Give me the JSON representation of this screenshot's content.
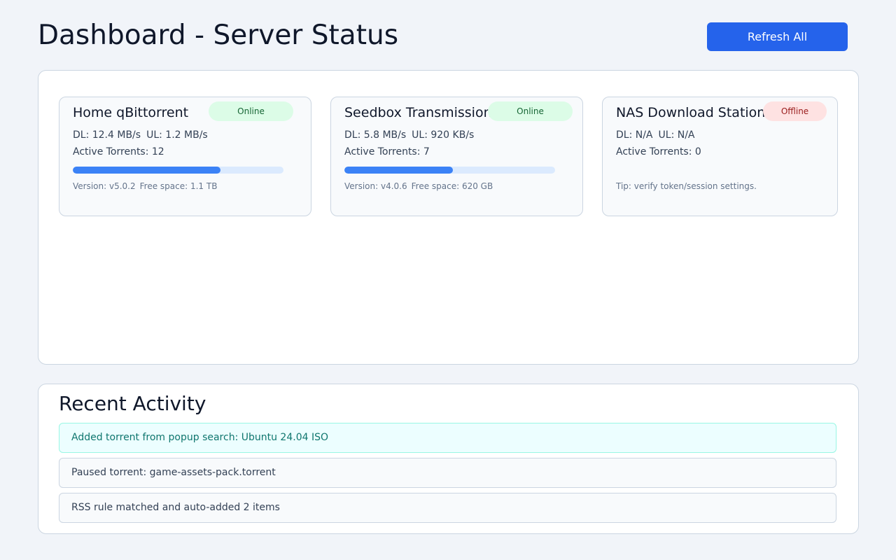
{
  "header": {
    "title": "Dashboard - Server Status",
    "refresh_label": "Refresh All"
  },
  "servers": [
    {
      "name": "Home qBittorrent",
      "status": "Online",
      "dl": "DL: 12.4 MB/s",
      "ul": "UL: 1.2 MB/s",
      "active": "Active Torrents: 12",
      "progress_percent": 70,
      "version": "Version: v5.0.2",
      "free_space": "Free space: 1.1 TB"
    },
    {
      "name": "Seedbox Transmission",
      "status": "Online",
      "dl": "DL: 5.8 MB/s",
      "ul": "UL: 920 KB/s",
      "active": "Active Torrents: 7",
      "progress_percent": 51.5,
      "version": "Version: v4.0.6",
      "free_space": "Free space: 620 GB"
    },
    {
      "name": "NAS Download Station",
      "status": "Offline",
      "dl": "DL: N/A",
      "ul": "UL: N/A",
      "active": "Active Torrents: 0",
      "tip": "Tip: verify token/session settings."
    }
  ],
  "activity": {
    "title": "Recent Activity",
    "items": [
      "Added torrent from popup search: Ubuntu 24.04 ISO",
      "Paused torrent: game-assets-pack.torrent",
      "RSS rule matched and auto-added 2 items"
    ]
  },
  "colors": {
    "accent": "#2563eb",
    "online_bg": "#dcfce7",
    "offline_bg": "#fee2e2",
    "progress": "#3b82f6"
  }
}
